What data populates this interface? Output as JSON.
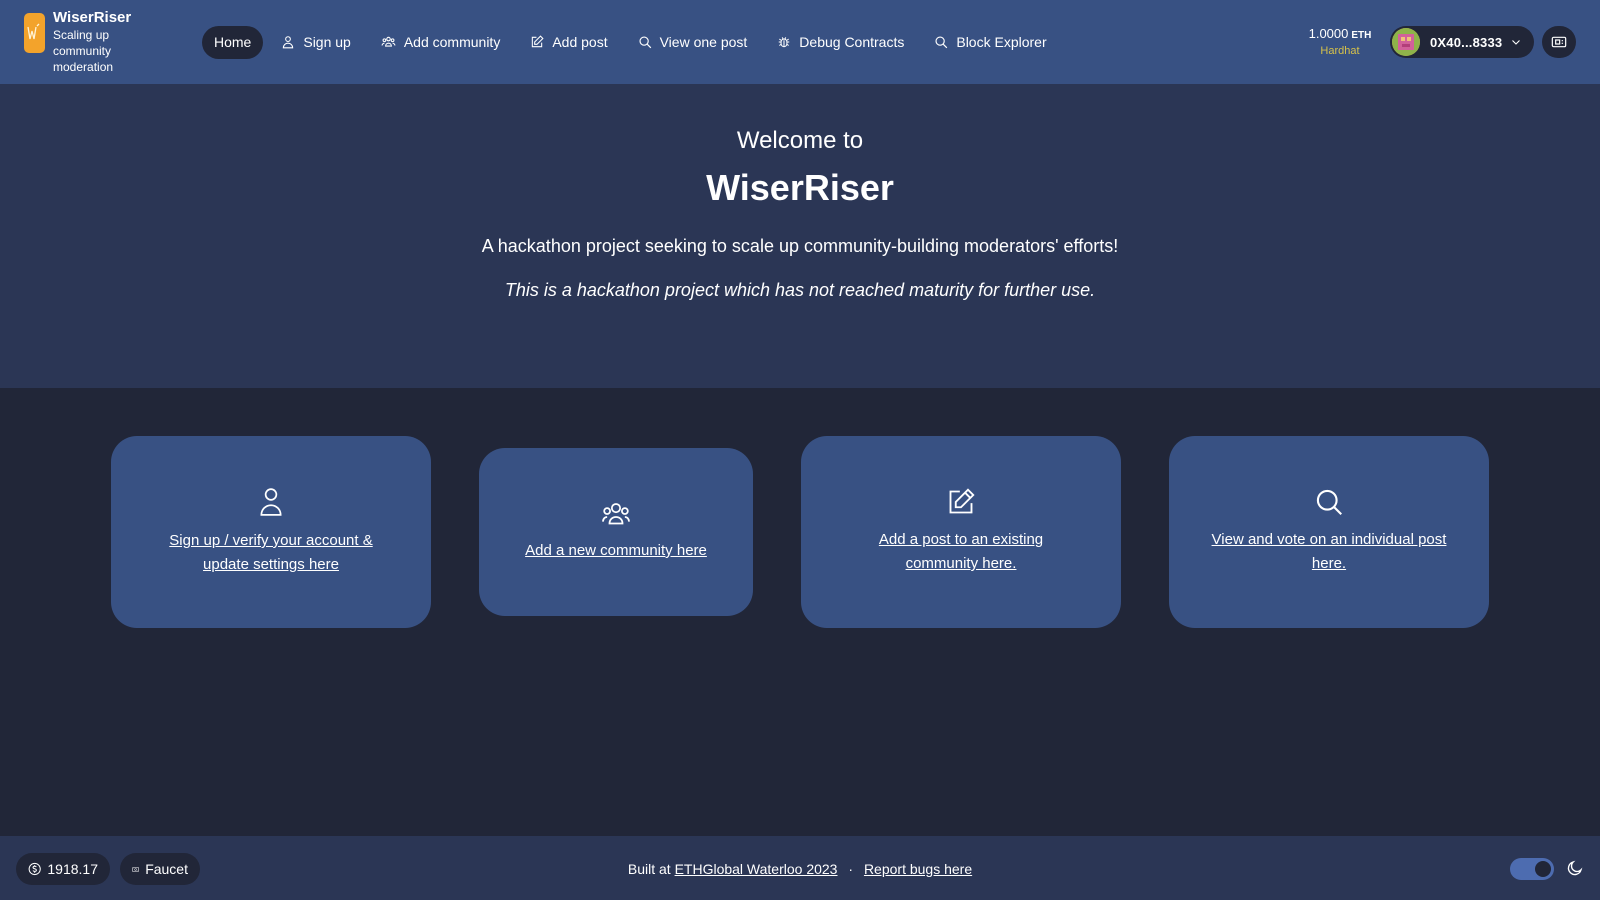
{
  "header": {
    "brand": {
      "name": "WiserRiser",
      "tagline": "Scaling up community moderation",
      "logo_icon": "wiserriser-logo-icon"
    },
    "nav": [
      {
        "label": "Home",
        "icon": "",
        "active": true
      },
      {
        "label": "Sign up",
        "icon": "user-icon",
        "active": false
      },
      {
        "label": "Add community",
        "icon": "community-icon",
        "active": false
      },
      {
        "label": "Add post",
        "icon": "edit-icon",
        "active": false
      },
      {
        "label": "View one post",
        "icon": "search-icon",
        "active": false
      },
      {
        "label": "Debug Contracts",
        "icon": "bug-icon",
        "active": false
      },
      {
        "label": "Block Explorer",
        "icon": "search-icon",
        "active": false
      }
    ],
    "balance": {
      "amount": "1.0000",
      "unit": "ETH",
      "network": "Hardhat"
    },
    "wallet": {
      "address": "0X40...8333"
    }
  },
  "hero": {
    "welcome": "Welcome to",
    "title": "WiserRiser",
    "description": "A hackathon project seeking to scale up community-building moderators' efforts!",
    "note": "This is a hackathon project which has not reached maturity for further use."
  },
  "cards": [
    {
      "icon": "user-icon",
      "link": "Sign up / verify your account & update settings here"
    },
    {
      "icon": "community-icon",
      "link": "Add a new community here"
    },
    {
      "icon": "edit-icon",
      "link": "Add a post to an existing community here."
    },
    {
      "icon": "search-icon",
      "link": "View and vote on an individual post here."
    }
  ],
  "footer": {
    "eth_price": "1918.17",
    "faucet_label": "Faucet",
    "built_at_prefix": "Built at",
    "built_at_link": "ETHGlobal Waterloo 2023",
    "separator": "·",
    "report_link": "Report bugs here"
  },
  "colors": {
    "header_bg": "#385183",
    "hero_bg": "#2b3655",
    "page_bg": "#212638",
    "card_bg": "#385183",
    "accent_network": "#d6c14a",
    "logo": "#f3a32b"
  }
}
